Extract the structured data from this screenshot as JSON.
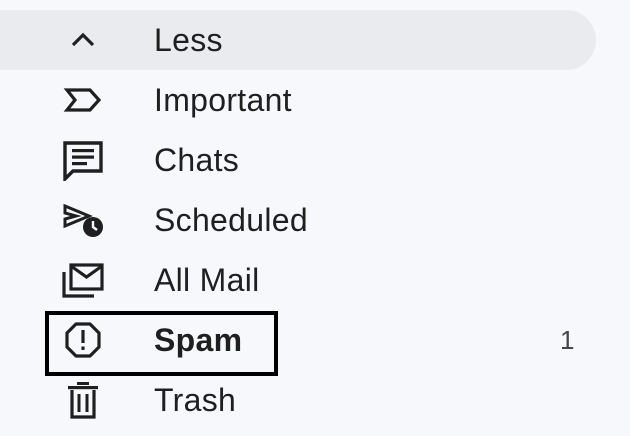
{
  "nav": {
    "items": [
      {
        "label": "Less",
        "icon": "chevron-up-icon",
        "count": ""
      },
      {
        "label": "Important",
        "icon": "important-label-icon",
        "count": ""
      },
      {
        "label": "Chats",
        "icon": "chat-bubble-icon",
        "count": ""
      },
      {
        "label": "Scheduled",
        "icon": "scheduled-send-icon",
        "count": ""
      },
      {
        "label": "All Mail",
        "icon": "all-mail-icon",
        "count": ""
      },
      {
        "label": "Spam",
        "icon": "spam-report-icon",
        "count": "1"
      },
      {
        "label": "Trash",
        "icon": "trash-icon",
        "count": ""
      }
    ]
  },
  "colors": {
    "background": "#f6f8fc",
    "hover_background": "#e9ebef",
    "text": "#1f1f1f",
    "highlight_border": "#000000"
  }
}
